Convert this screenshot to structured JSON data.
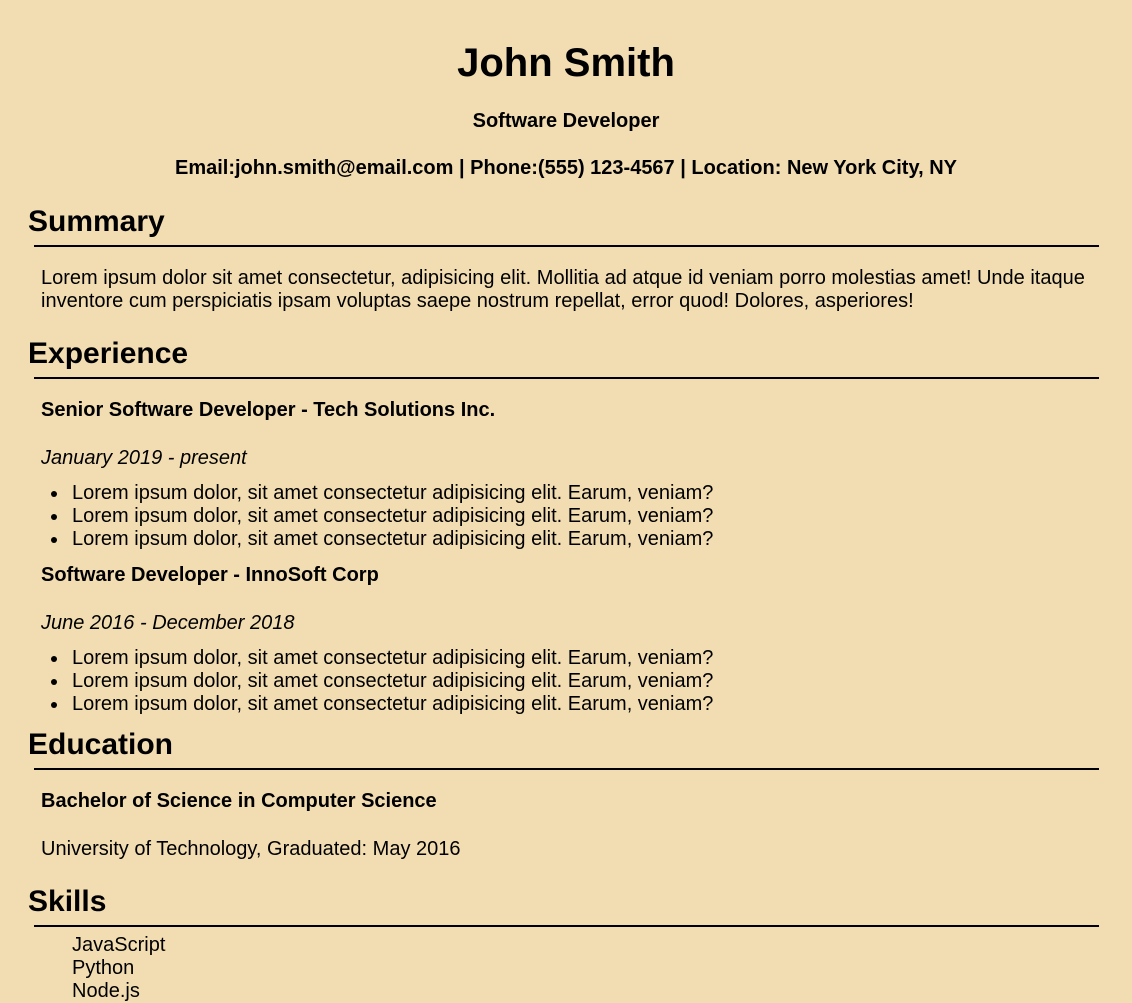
{
  "header": {
    "name": "John Smith",
    "title": "Software Developer",
    "contact": "Email:john.smith@email.com | Phone:(555) 123-4567 | Location: New York City, NY"
  },
  "summary": {
    "heading": "Summary",
    "text": "Lorem ipsum dolor sit amet consectetur, adipisicing elit. Mollitia ad atque id veniam porro molestias amet! Unde itaque inventore cum perspiciatis ipsam voluptas saepe nostrum repellat, error quod! Dolores, asperiores!"
  },
  "experience": {
    "heading": "Experience",
    "jobs": [
      {
        "title": "Senior Software Developer - Tech Solutions Inc.",
        "dates": "January 2019 - present",
        "bullets": [
          "Lorem ipsum dolor, sit amet consectetur adipisicing elit. Earum, veniam?",
          "Lorem ipsum dolor, sit amet consectetur adipisicing elit. Earum, veniam?",
          "Lorem ipsum dolor, sit amet consectetur adipisicing elit. Earum, veniam?"
        ]
      },
      {
        "title": "Software Developer - InnoSoft Corp",
        "dates": "June 2016 - December 2018",
        "bullets": [
          "Lorem ipsum dolor, sit amet consectetur adipisicing elit. Earum, veniam?",
          "Lorem ipsum dolor, sit amet consectetur adipisicing elit. Earum, veniam?",
          "Lorem ipsum dolor, sit amet consectetur adipisicing elit. Earum, veniam?"
        ]
      }
    ]
  },
  "education": {
    "heading": "Education",
    "degree": "Bachelor of Science in Computer Science",
    "detail": "University of Technology, Graduated: May 2016"
  },
  "skills": {
    "heading": "Skills",
    "items": [
      "JavaScript",
      "Python",
      "Node.js"
    ]
  }
}
